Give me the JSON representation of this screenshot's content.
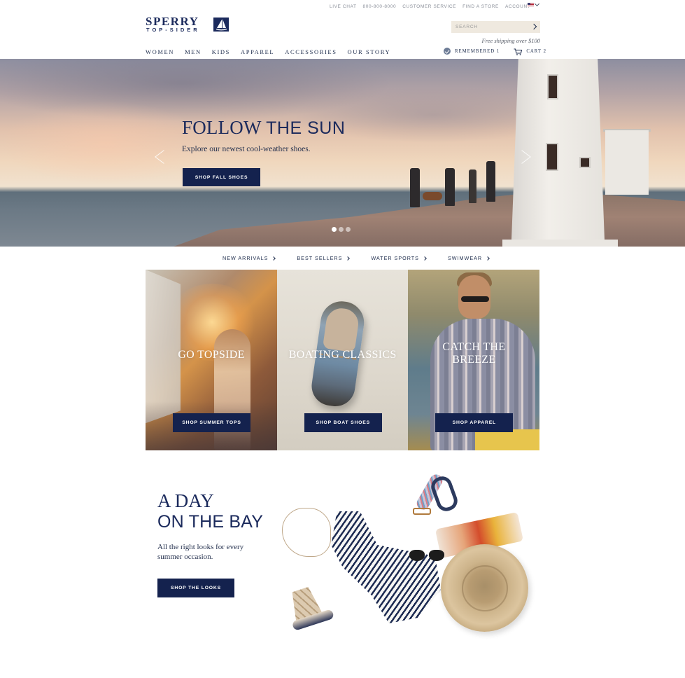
{
  "header": {
    "utility_links": [
      "LIVE CHAT",
      "800-800-8000",
      "CUSTOMER SERVICE",
      "FIND A STORE",
      "ACCOUNT"
    ],
    "logo": {
      "line1": "SPERRY",
      "line2": "TOP-SIDER"
    },
    "search": {
      "placeholder": "SEARCH",
      "value": ""
    },
    "shipping_note": "Free shipping over $100",
    "nav": [
      "WOMEN",
      "MEN",
      "KIDS",
      "APPAREL",
      "ACCESSORIES",
      "OUR STORY"
    ],
    "remembered_label": "REMEMBERED 1",
    "cart_label": "CART 2"
  },
  "hero": {
    "title_serif": "FOLLOW",
    "title_sans": "THE SUN",
    "subtitle": "Explore our newest cool-weather shoes.",
    "cta_label": "SHOP FALL SHOES",
    "slide_count": 3,
    "active_slide": 1
  },
  "category_links": [
    {
      "label": "NEW ARRIVALS"
    },
    {
      "label": "BEST SELLERS"
    },
    {
      "label": "WATER SPORTS"
    },
    {
      "label": "SWIMWEAR"
    }
  ],
  "tiles": [
    {
      "title_a": "GO",
      "title_b": "TOPSIDE",
      "cta": "SHOP SUMMER TOPS"
    },
    {
      "title_a": "BOATING",
      "title_b": "CLASSICS",
      "cta": "SHOP BOAT SHOES"
    },
    {
      "title_a": "CATCH THE",
      "title_b": "BREEZE",
      "cta": "SHOP APPAREL"
    }
  ],
  "bay": {
    "title_line1": "A DAY",
    "title_line2": "ON THE BAY",
    "subtitle": "All the right looks for every summer occasion.",
    "cta_label": "SHOP THE LOOKS"
  },
  "colors": {
    "navy": "#14224e",
    "brand_text": "#1b2a5c",
    "search_bg": "#efe9df"
  },
  "icons": [
    "flag-us-icon",
    "chevron-down-icon",
    "search-arrow-icon",
    "check-circle-icon",
    "cart-icon",
    "prev-arrow-icon",
    "next-arrow-icon",
    "chevron-right-icon"
  ]
}
